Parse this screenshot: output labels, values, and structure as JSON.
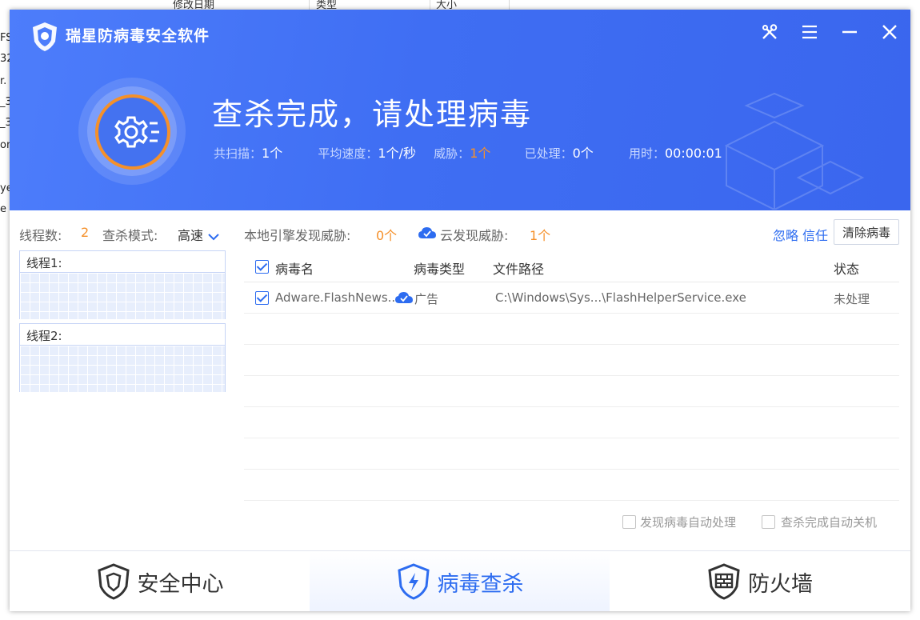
{
  "background_window": {
    "columns": [
      "修改日期",
      "类型",
      "大小"
    ],
    "row_fragments": [
      "FS",
      "32",
      "r.",
      "_3",
      "_3",
      "on",
      "ye",
      "e"
    ]
  },
  "app": {
    "title": "瑞星防病毒安全软件",
    "window_controls": [
      "tools-icon",
      "menu-icon",
      "minimize-icon",
      "close-icon"
    ]
  },
  "scan": {
    "headline": "查杀完成，请处理病毒",
    "stats": {
      "scanned_label": "共扫描：",
      "scanned_value": "1个",
      "speed_label": "平均速度：",
      "speed_value": "1个/秒",
      "threat_label": "威胁：",
      "threat_value": "1个",
      "handled_label": "已处理：",
      "handled_value": "0个",
      "time_label": "用时：",
      "time_value": "00:00:01"
    }
  },
  "toolbar": {
    "threads_label": "线程数:",
    "threads_value": "2",
    "mode_label": "查杀模式:",
    "mode_value": "高速",
    "local_label": "本地引擎发现威胁:",
    "local_value": "0个",
    "cloud_label": "云发现威胁:",
    "cloud_value": "1个",
    "ignore": "忽略",
    "trust": "信任",
    "clear": "清除病毒"
  },
  "threads": [
    {
      "label": "线程1:"
    },
    {
      "label": "线程2:"
    }
  ],
  "table": {
    "headers": {
      "name": "病毒名",
      "type": "病毒类型",
      "path": "文件路径",
      "status": "状态"
    },
    "rows": [
      {
        "checked": true,
        "name": "Adware.FlashNews...",
        "type": "广告",
        "path": "C:\\Windows\\Sys...\\FlashHelperService.exe",
        "status": "未处理"
      }
    ]
  },
  "options": {
    "auto_handle": "发现病毒自动处理",
    "auto_shutdown": "查杀完成自动关机"
  },
  "nav": {
    "items": [
      {
        "label": "安全中心",
        "active": false
      },
      {
        "label": "病毒查杀",
        "active": true
      },
      {
        "label": "防火墙",
        "active": false
      }
    ]
  },
  "colors": {
    "brand_blue": "#3f6ef3",
    "accent_orange": "#f5902a",
    "link_blue": "#2d6cf0"
  }
}
